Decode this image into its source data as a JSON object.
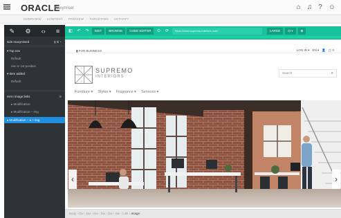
{
  "topbar": {
    "logo": "ORACLE",
    "product": "Maxymiser",
    "icons": [
      "home-icon",
      "bell-icon",
      "help-icon",
      "user-icon"
    ]
  },
  "subnav": [
    "OVERVIEW",
    "CONTENT",
    "PREVIEW",
    "TARGETING",
    "ACTIVITY"
  ],
  "left_panel": {
    "tools": [
      "pencil-icon",
      "gear-icon",
      "code-icon",
      "filter-icon"
    ],
    "rows": [
      {
        "label": "side maxymised",
        "type": "head",
        "right": "▮ ⧉ +"
      },
      {
        "label": "▾ Top nav",
        "type": "head"
      },
      {
        "label": "Default",
        "type": "indent"
      },
      {
        "label": "nav in 1st position",
        "type": "indent"
      },
      {
        "label": "▾ Item added",
        "type": "head"
      },
      {
        "label": "Default",
        "type": "indent"
      },
      {
        "label": "Hero image links",
        "type": "head",
        "right": "⊕"
      },
      {
        "label": "▸ Modification",
        "type": "indent"
      },
      {
        "label": "▸ Modification – img",
        "type": "indent"
      },
      {
        "label": "▸ Modification – a + img",
        "type": "sel"
      }
    ]
  },
  "editor_toolbar": {
    "left": [
      "◧",
      "↶",
      "↷"
    ],
    "buttons": [
      "EDIT",
      "BROWSE",
      "CODE EDITOR"
    ],
    "mid_icons": [
      "⊙",
      "⟳"
    ],
    "url": "https://www.suprema-interiors.com/",
    "right": [
      "LARGE",
      "⊡ ▾",
      "⊞"
    ]
  },
  "site": {
    "top_left": "▮ FOR BUSINESS",
    "lang": [
      "LOG IN ▾",
      "EN ▾",
      "👤",
      "🛒0"
    ],
    "brand_name": "SUPREMO",
    "brand_sub": "INTERIORS",
    "search_placeholder": "Search",
    "nav": [
      "Furniture ▾",
      "Styles ▾",
      "Fragrance ▾",
      "Services ▾"
    ],
    "arrow_left": "‹",
    "arrow_right": "›"
  },
  "status": {
    "path": "Body  ›  Div  ›  Div  ›  Div  ›  Div  ›  Div  ›  Div  ›  Link  ›  ",
    "current": "Image"
  },
  "colors": {
    "accent": "#18c29d",
    "panel": "#2e3337",
    "selection": "#1f8fe0"
  }
}
